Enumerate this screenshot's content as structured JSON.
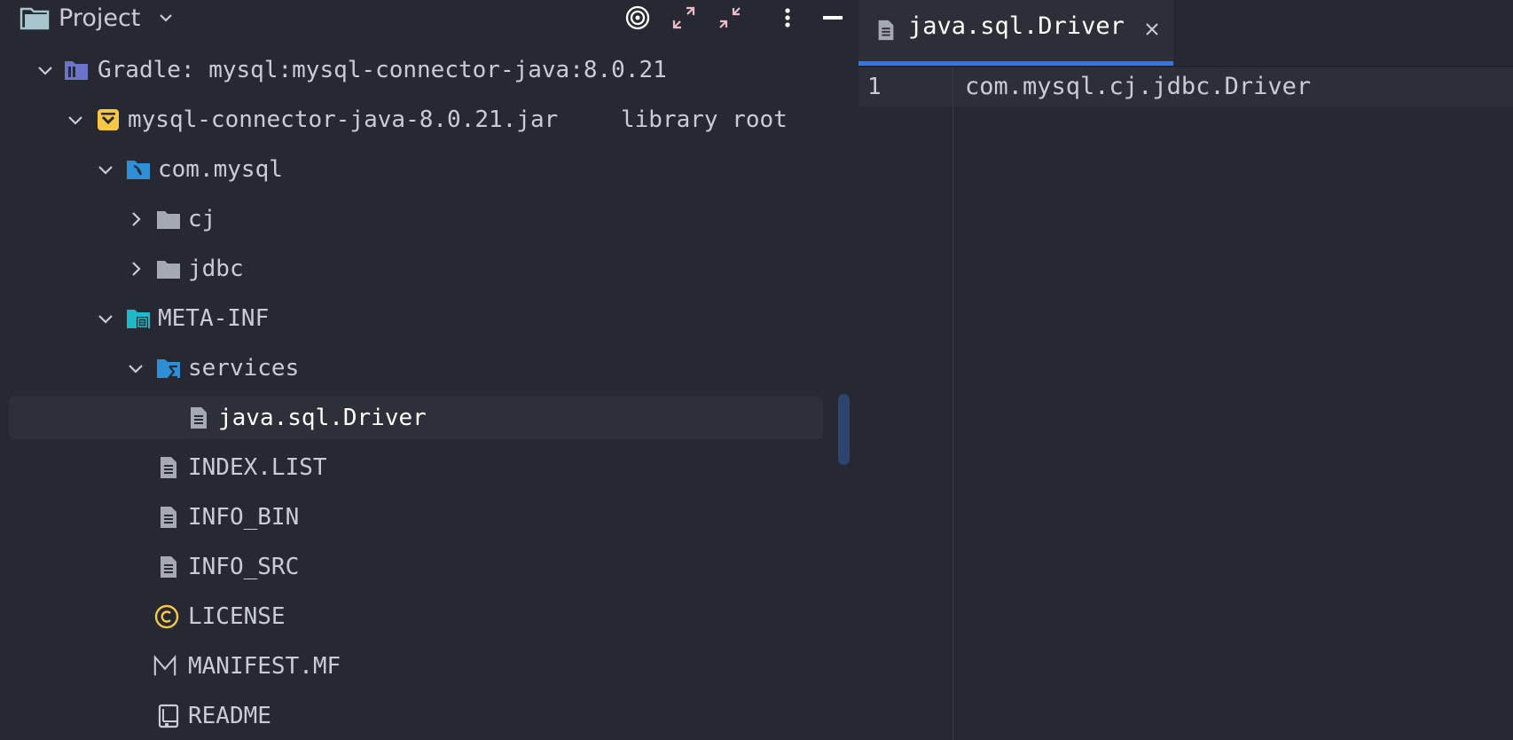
{
  "project_panel": {
    "title": "Project",
    "tree": [
      {
        "label": "Gradle: mysql:mysql-connector-java:8.0.21",
        "icon": "library-icon",
        "expanded": true
      },
      {
        "label": "mysql-connector-java-8.0.21.jar",
        "suffix": "library root",
        "icon": "jar-icon",
        "expanded": true
      },
      {
        "label": "com.mysql",
        "icon": "package-icon",
        "expanded": true
      },
      {
        "label": "cj",
        "icon": "folder-icon",
        "expanded": false
      },
      {
        "label": "jdbc",
        "icon": "folder-icon",
        "expanded": false
      },
      {
        "label": "META-INF",
        "icon": "resource-folder-icon",
        "expanded": true
      },
      {
        "label": "services",
        "icon": "services-folder-icon",
        "expanded": true
      },
      {
        "label": "java.sql.Driver",
        "icon": "text-file-icon",
        "selected": true
      },
      {
        "label": "INDEX.LIST",
        "icon": "text-file-icon"
      },
      {
        "label": "INFO_BIN",
        "icon": "text-file-icon"
      },
      {
        "label": "INFO_SRC",
        "icon": "text-file-icon"
      },
      {
        "label": "LICENSE",
        "icon": "copyright-icon"
      },
      {
        "label": "MANIFEST.MF",
        "icon": "manifest-icon"
      },
      {
        "label": "README",
        "icon": "readme-icon"
      }
    ]
  },
  "editor": {
    "tab": {
      "label": "java.sql.Driver",
      "icon": "text-file-icon"
    },
    "lines": [
      {
        "number": "1",
        "text": "com.mysql.cj.jdbc.Driver"
      }
    ]
  },
  "colors": {
    "accent": "#3574f0",
    "background": "#262932",
    "folder_gray": "#a5a9b2",
    "jar_yellow": "#f5c744",
    "package_blue": "#2e8fd6"
  }
}
